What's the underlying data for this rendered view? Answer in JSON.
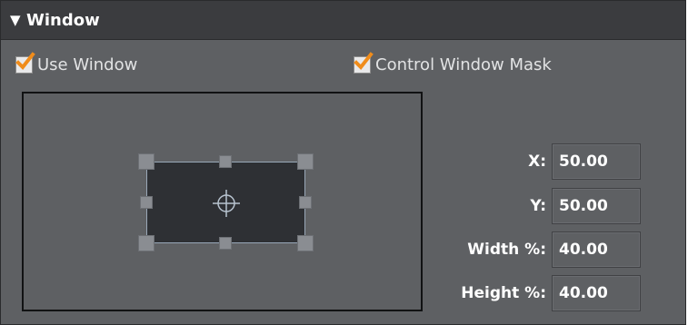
{
  "section": {
    "title": "Window",
    "collapse_icon": "triangle-down-icon"
  },
  "options": {
    "use_window": {
      "label": "Use Window",
      "checked": true
    },
    "control_window_mask": {
      "label": "Control Window Mask",
      "checked": true
    }
  },
  "fields": [
    {
      "label": "X:",
      "value": "50.00"
    },
    {
      "label": "Y:",
      "value": "50.00"
    },
    {
      "label": "Width %:",
      "value": "40.00"
    },
    {
      "label": "Height %:",
      "value": "40.00"
    }
  ],
  "colors": {
    "panel_bg": "#5e6063",
    "header_bg": "#3b3c3f",
    "check_mark": "#f08c1a",
    "window_frame": "#99a8b8"
  }
}
